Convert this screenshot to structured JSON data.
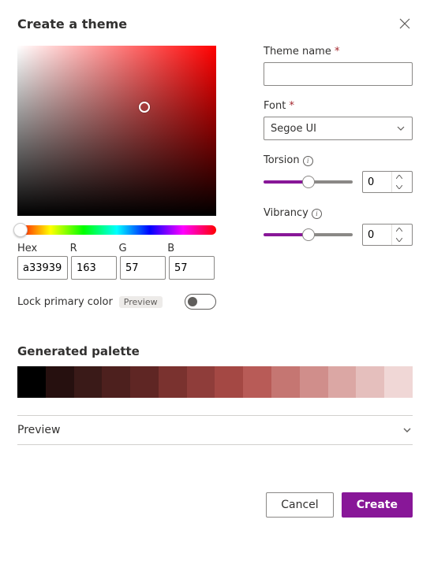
{
  "header": {
    "title": "Create a theme"
  },
  "colorPicker": {
    "labels": {
      "hex": "Hex",
      "r": "R",
      "g": "G",
      "b": "B"
    },
    "hex": "a33939",
    "r": "163",
    "g": "57",
    "b": "57",
    "hue_position": 0
  },
  "lock": {
    "label": "Lock primary color",
    "badge": "Preview",
    "on": false
  },
  "form": {
    "themeName": {
      "label": "Theme name",
      "required": true,
      "value": ""
    },
    "font": {
      "label": "Font",
      "required": true,
      "value": "Segoe UI"
    },
    "torsion": {
      "label": "Torsion",
      "value": "0"
    },
    "vibrancy": {
      "label": "Vibrancy",
      "value": "0"
    }
  },
  "palette": {
    "title": "Generated palette",
    "swatches": [
      "#000000",
      "#26100f",
      "#3a1a18",
      "#4d201e",
      "#5f2624",
      "#7a322f",
      "#8f3d3a",
      "#a44844",
      "#b85b57",
      "#c57672",
      "#d08e8b",
      "#dba7a4",
      "#e5bfbd",
      "#f0d7d6"
    ]
  },
  "preview": {
    "label": "Preview"
  },
  "footer": {
    "cancel": "Cancel",
    "create": "Create"
  }
}
